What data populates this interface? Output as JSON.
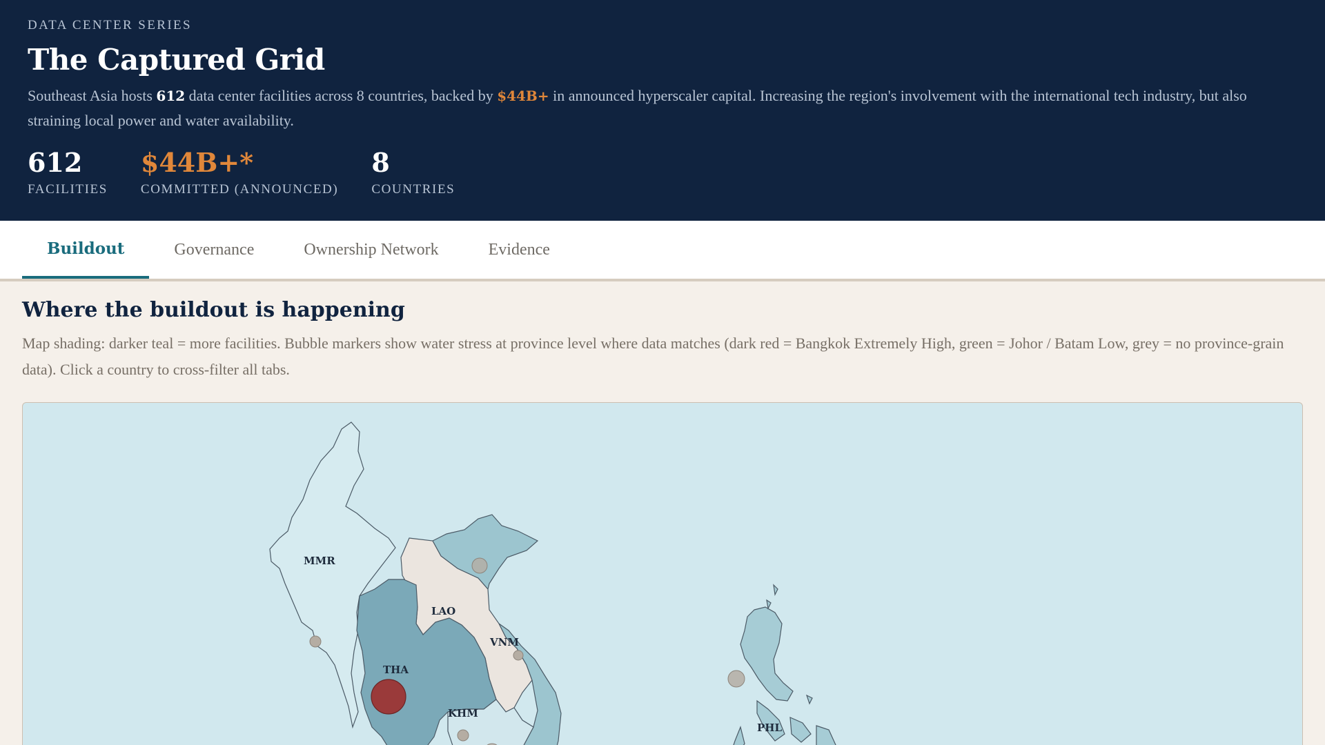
{
  "header": {
    "eyebrow": "DATA CENTER SERIES",
    "title": "The Captured Grid",
    "subtitle": {
      "part1": "Southeast Asia hosts ",
      "facilities_count": "612",
      "part2": " data center facilities across 8 countries, backed by ",
      "capital": "$44B+",
      "part3": " in announced hyperscaler capital. Increasing the region's involvement with the international tech industry, but also straining local power and water availability."
    },
    "stats": [
      {
        "value": "612",
        "label": "FACILITIES"
      },
      {
        "value": "$44B+*",
        "label": "COMMITTED (ANNOUNCED)"
      },
      {
        "value": "8",
        "label": "COUNTRIES"
      }
    ]
  },
  "tabs": [
    {
      "label": "Buildout",
      "active": true
    },
    {
      "label": "Governance",
      "active": false
    },
    {
      "label": "Ownership Network",
      "active": false
    },
    {
      "label": "Evidence",
      "active": false
    }
  ],
  "section": {
    "title": "Where the buildout is happening",
    "description": "Map shading: darker teal = more facilities. Bubble markers show water stress at province level where data matches (dark red = Bangkok Extremely High, green = Johor / Batam Low, grey = no province-grain data). Click a country to cross-filter all tabs."
  },
  "map": {
    "country_labels": [
      "MMR",
      "LAO",
      "THA",
      "VNM",
      "KHM",
      "PHL"
    ],
    "colors": {
      "ocean": "#d1e8ee",
      "mmr": "#d6ebf0",
      "lao": "#ebe5df",
      "tha": "#7ba9b8",
      "vnm": "#9cc5cf",
      "khm": "#d2e7ed",
      "phl": "#a6ccd5",
      "bubble_extreme": "#9a3a3a",
      "bubble_none": "#b5ada3",
      "border": "#4b5a66"
    }
  }
}
